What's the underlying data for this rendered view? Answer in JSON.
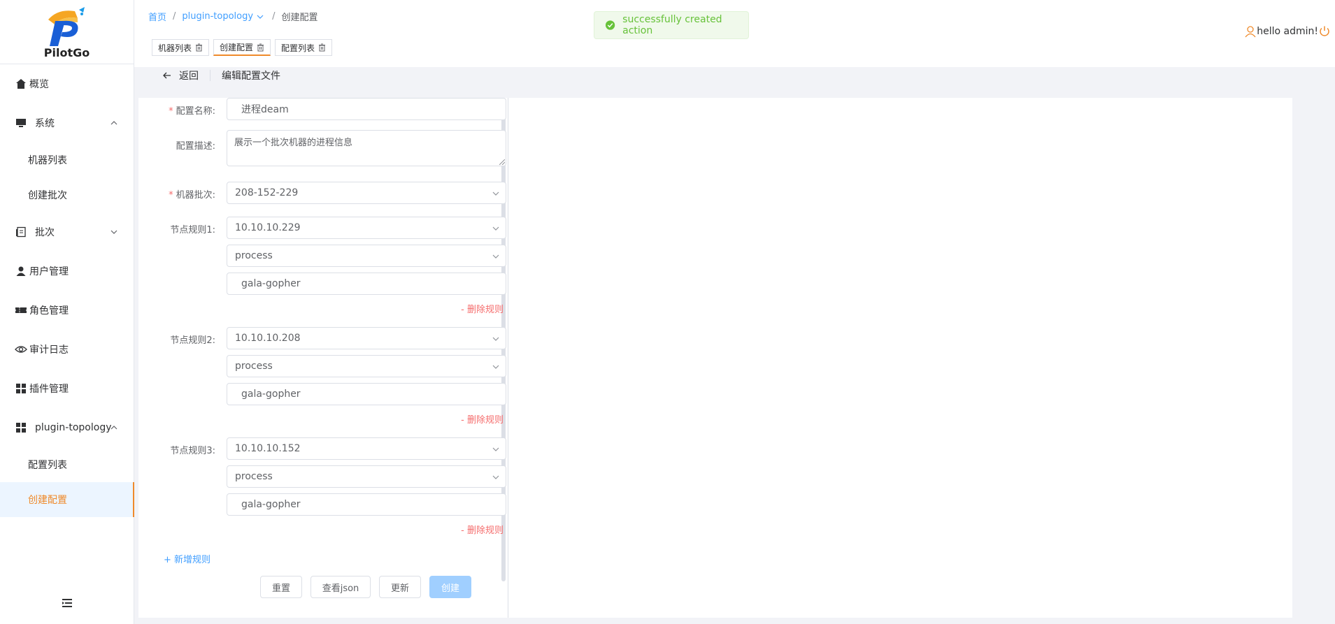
{
  "brand": {
    "name": "PilotGo"
  },
  "sidebar": {
    "items": [
      {
        "label": "概览",
        "icon": "home-icon"
      },
      {
        "label": "系统",
        "icon": "monitor-icon",
        "expanded": true
      },
      {
        "label": "机器列表"
      },
      {
        "label": "创建批次"
      },
      {
        "label": "批次",
        "icon": "batch-icon",
        "expanded": false
      },
      {
        "label": "用户管理",
        "icon": "user-icon"
      },
      {
        "label": "角色管理",
        "icon": "ticket-icon"
      },
      {
        "label": "审计日志",
        "icon": "eye-icon"
      },
      {
        "label": "插件管理",
        "icon": "grid-icon"
      },
      {
        "label": "plugin-topology",
        "icon": "grid-icon",
        "expanded": true
      },
      {
        "label": "配置列表"
      },
      {
        "label": "创建配置",
        "active": true
      }
    ]
  },
  "breadcrumb": {
    "home": "首页",
    "plugin": "plugin-topology",
    "current": "创建配置"
  },
  "tags": [
    {
      "label": "机器列表"
    },
    {
      "label": "创建配置",
      "active": true
    },
    {
      "label": "配置列表"
    }
  ],
  "user": {
    "greeting": "hello admin!"
  },
  "toast": {
    "message": "successfully created action",
    "type": "success"
  },
  "page": {
    "back": "返回",
    "title": "编辑配置文件"
  },
  "form": {
    "name_label": "配置名称:",
    "name_value": "进程deam",
    "desc_label": "配置描述:",
    "desc_value": "展示一个批次机器的进程信息",
    "batch_label": "机器批次:",
    "batch_value": "208-152-229",
    "rules": [
      {
        "label": "节点规则1:",
        "ip": "10.10.10.229",
        "type": "process",
        "name": "gala-gopher",
        "delete": "- 删除规则"
      },
      {
        "label": "节点规则2:",
        "ip": "10.10.10.208",
        "type": "process",
        "name": "gala-gopher",
        "delete": "- 删除规则"
      },
      {
        "label": "节点规则3:",
        "ip": "10.10.10.152",
        "type": "process",
        "name": "gala-gopher",
        "delete": "- 删除规则"
      }
    ],
    "add_rule": "+ 新增规则",
    "buttons": {
      "reset": "重置",
      "view_json": "查看json",
      "update": "更新",
      "create": "创建"
    }
  },
  "colors": {
    "accent": "#ef8a2b",
    "primary": "#409eff",
    "danger": "#f56c6c",
    "success": "#67c23a"
  }
}
